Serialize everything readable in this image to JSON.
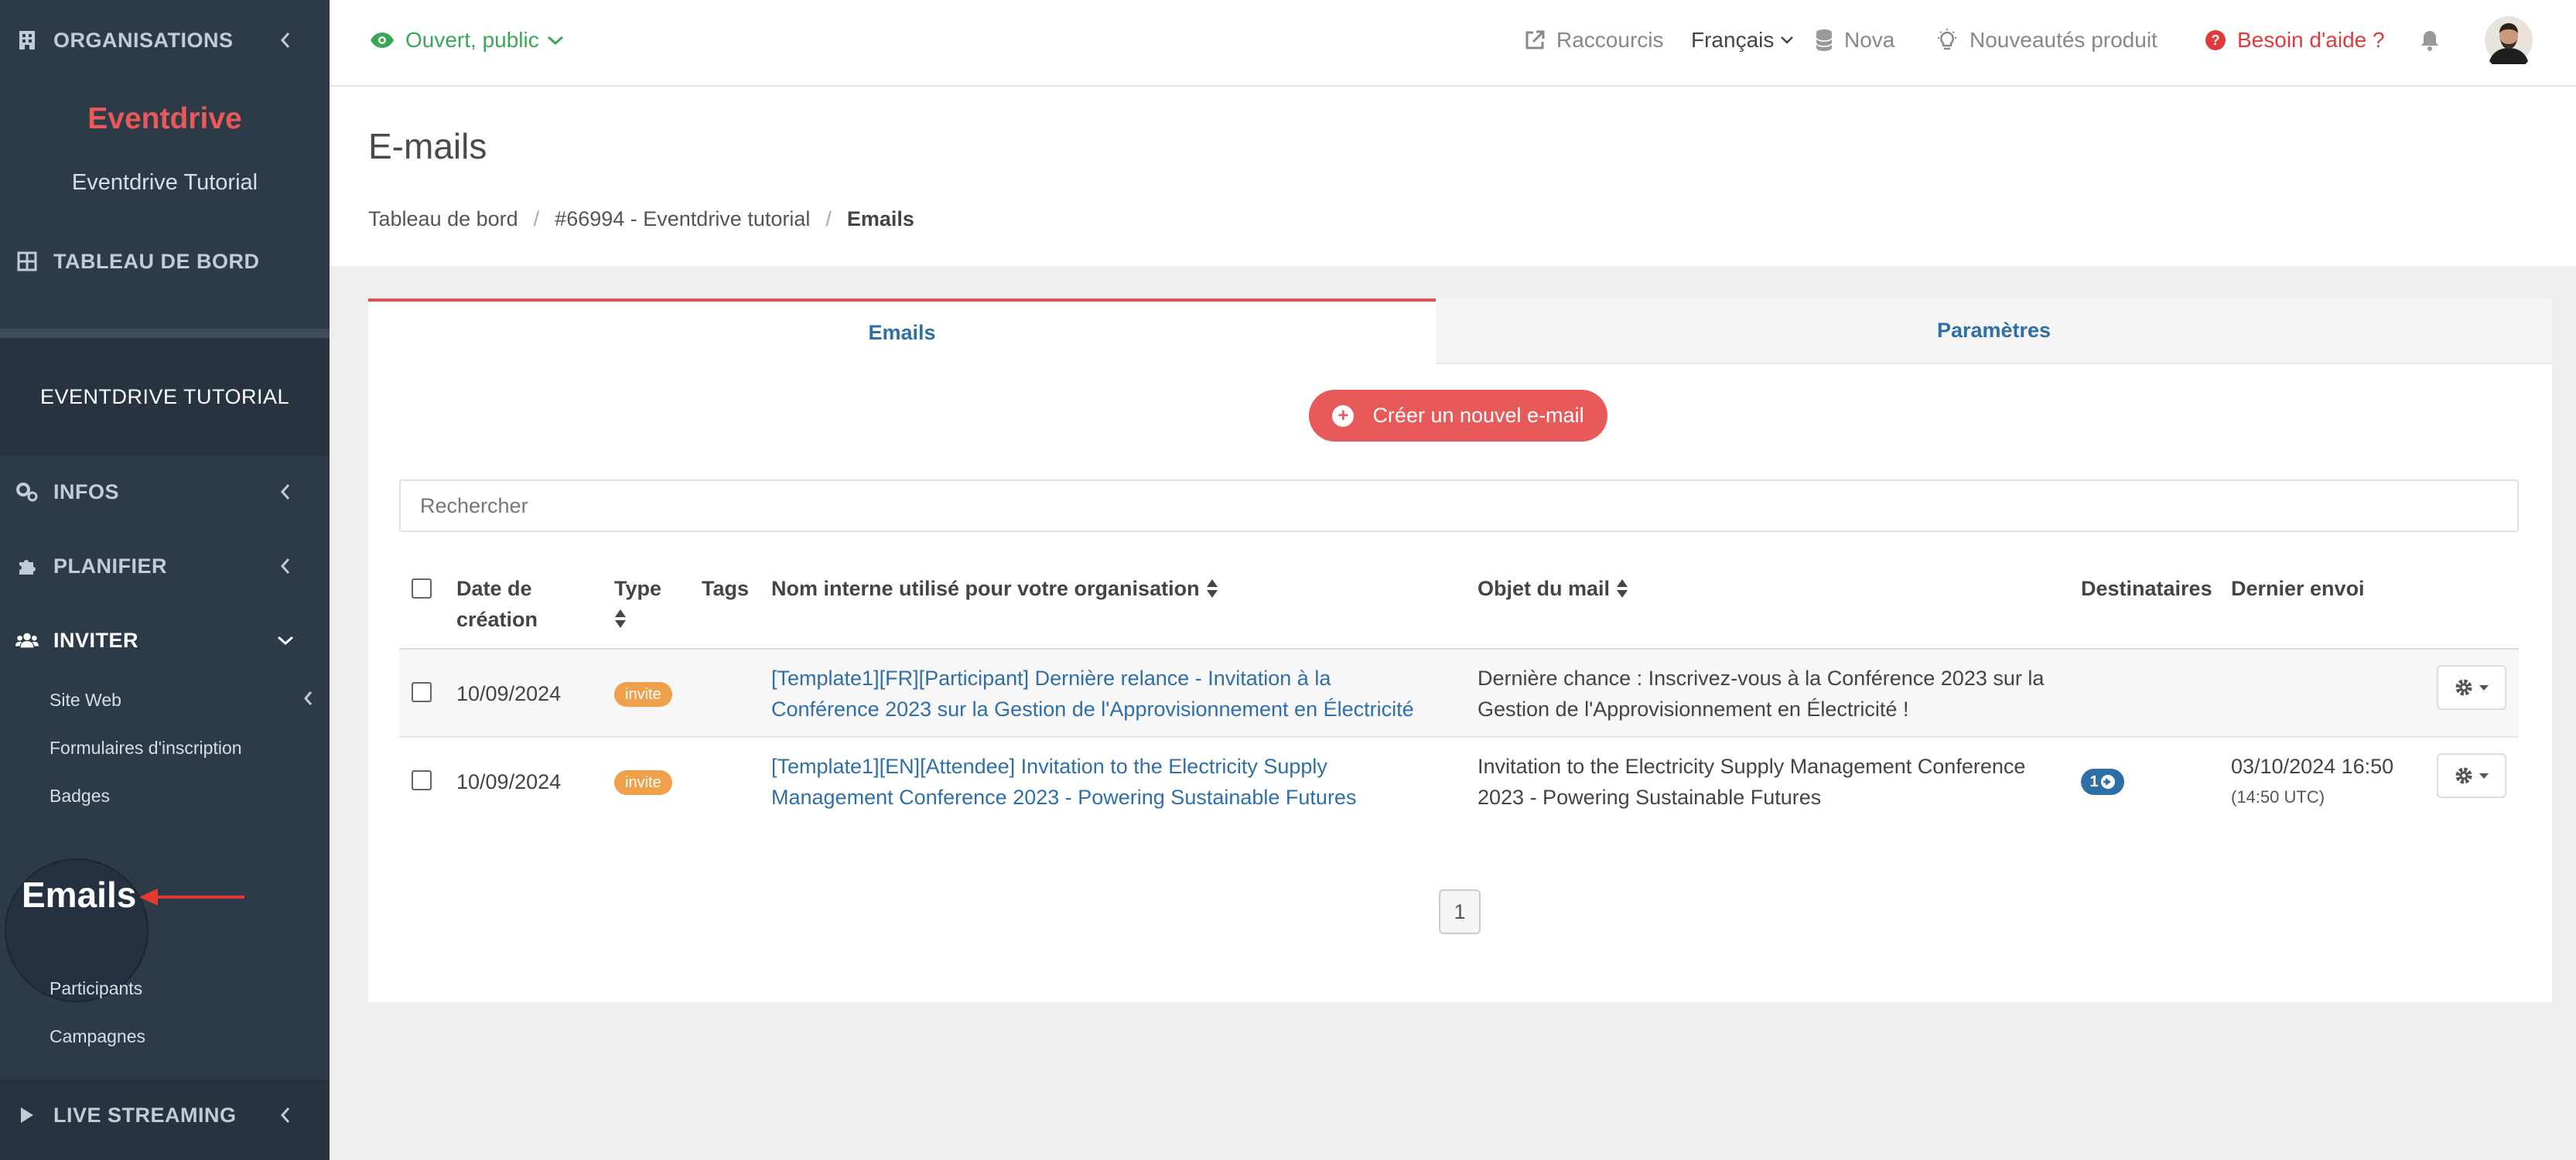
{
  "sidebar": {
    "organisations_label": "ORGANISATIONS",
    "brand": "Eventdrive",
    "brand_subtitle": "Eventdrive Tutorial",
    "dashboard_label": "TABLEAU DE BORD",
    "event_label": "EVENTDRIVE TUTORIAL",
    "sections": {
      "infos": "INFOS",
      "planifier": "PLANIFIER",
      "inviter": "INVITER",
      "live": "LIVE STREAMING"
    },
    "sub_items": {
      "site_web": "Site Web",
      "formulaires": "Formulaires d'inscription",
      "badges": "Badges",
      "emails": "Emails",
      "participants": "Participants",
      "campagnes": "Campagnes"
    },
    "brand_color": "#e85a5a"
  },
  "topbar": {
    "status": "Ouvert, public",
    "raccourcis": "Raccourcis",
    "language": "Français",
    "nova": "Nova",
    "nouveautes": "Nouveautés produit",
    "aide": "Besoin d'aide ?",
    "status_color": "#3aa757",
    "aide_color": "#e03b3b"
  },
  "page": {
    "title": "E-mails",
    "breadcrumb": [
      "Tableau de bord",
      "#66994 - Eventdrive tutorial",
      "Emails"
    ]
  },
  "tabs": {
    "emails": "Emails",
    "parametres": "Paramètres"
  },
  "create_button": "Créer un nouvel e-mail",
  "search_placeholder": "Rechercher",
  "table": {
    "headers": {
      "date_l1": "Date de",
      "date_l2": "création",
      "type": "Type",
      "tags": "Tags",
      "nom": "Nom interne utilisé pour votre organisation",
      "objet": "Objet du mail",
      "destinataires": "Destinataires",
      "dernier_envoi": "Dernier envoi"
    },
    "rows": [
      {
        "date": "10/09/2024",
        "type": "invite",
        "name_l1": "[Template1][FR][Participant] Dernière relance - Invitation à la",
        "name_l2": "Conférence 2023 sur la Gestion de l'Approvisionnement en Électricité",
        "subject_l1": "Dernière chance : Inscrivez-vous à la Conférence 2023 sur la",
        "subject_l2": "Gestion de l'Approvisionnement en Électricité !",
        "recipients": "",
        "last_sent": "",
        "last_sent_utc": ""
      },
      {
        "date": "10/09/2024",
        "type": "invite",
        "name_l1": "[Template1][EN][Attendee] Invitation to the Electricity Supply",
        "name_l2": "Management Conference 2023 - Powering Sustainable Futures",
        "subject_l1": "Invitation to the Electricity Supply Management Conference",
        "subject_l2": "2023 - Powering Sustainable Futures",
        "recipients": "1",
        "last_sent": "03/10/2024 16:50",
        "last_sent_utc": "(14:50 UTC)"
      }
    ]
  },
  "pagination": {
    "current": "1"
  }
}
